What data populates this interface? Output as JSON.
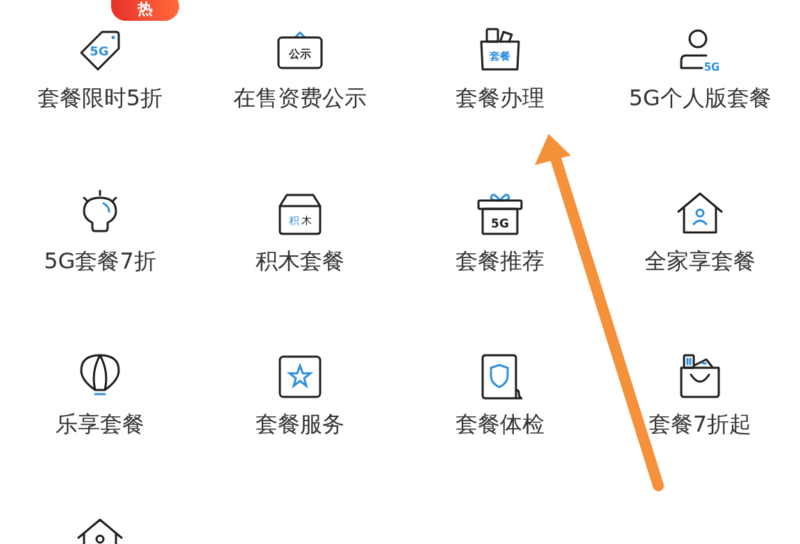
{
  "badge": {
    "text": "热"
  },
  "items": [
    {
      "kind": "tag",
      "icon_text": "5G",
      "label": "套餐限时5折"
    },
    {
      "kind": "sign",
      "icon_text": "公示",
      "label": "在售资费公示"
    },
    {
      "kind": "bag",
      "icon_text": "套餐",
      "label": "套餐办理"
    },
    {
      "kind": "person",
      "icon_text": "5G",
      "label": "5G个人版套餐"
    },
    {
      "kind": "bulb",
      "label": "5G套餐7折"
    },
    {
      "kind": "box",
      "icon_text": "积木",
      "label": "积木套餐"
    },
    {
      "kind": "gift",
      "icon_text": "5G",
      "label": "套餐推荐"
    },
    {
      "kind": "home-person",
      "label": "全家享套餐"
    },
    {
      "kind": "balloon",
      "label": "乐享套餐"
    },
    {
      "kind": "star-card",
      "label": "套餐服务"
    },
    {
      "kind": "shield-doc",
      "label": "套餐体检"
    },
    {
      "kind": "shop-bag",
      "label": "套餐7折起"
    },
    {
      "kind": "home"
    }
  ],
  "annotations": [
    {
      "kind": "arrow"
    }
  ]
}
